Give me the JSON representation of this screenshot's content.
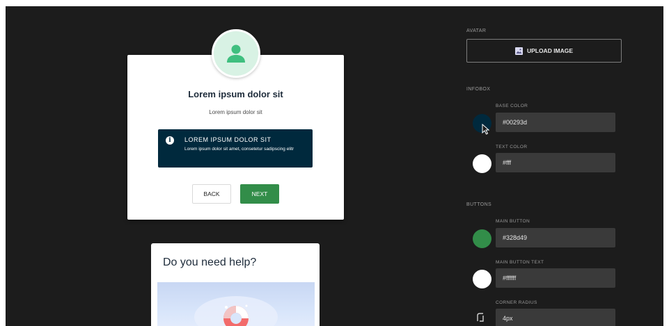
{
  "colors": {
    "panel_bg": "#1c1c1c",
    "infobox_base": "#00293d",
    "infobox_text": "#fff",
    "main_button": "#328d49",
    "main_button_text": "#ffffff",
    "avatar_bg": "#d8f2e4",
    "avatar_icon": "#3fbf7f"
  },
  "preview": {
    "avatar_icon": "user-icon",
    "title": "Lorem ipsum dolor sit",
    "subtitle": "Lorem ipsum dolor sit",
    "infobox": {
      "icon": "info-icon",
      "icon_glyph": "i",
      "title": "LOREM IPSUM DOLOR SIT",
      "text": "Lorem ipsum dolor sit amet, consetetur sadipscing elitr"
    },
    "back_label": "BACK",
    "next_label": "NEXT"
  },
  "help": {
    "title": "Do you need help?",
    "image_icon": "lifebuoy-icon"
  },
  "settings": {
    "avatar": {
      "section": "AVATAR",
      "upload_label": "UPLOAD IMAGE",
      "upload_icon": "image-icon"
    },
    "infobox": {
      "section": "INFOBOX",
      "base_color_label": "BASE COLOR",
      "base_color_value": "#00293d",
      "text_color_label": "TEXT COLOR",
      "text_color_value": "#fff"
    },
    "buttons": {
      "section": "BUTTONS",
      "main_button_label": "MAIN BUTTON",
      "main_button_value": "#328d49",
      "main_button_text_label": "MAIN BUTTON TEXT",
      "main_button_text_value": "#ffffff",
      "corner_radius_label": "CORNER RADIUS",
      "corner_radius_value": "4px",
      "corner_radius_icon": "corner-radius-icon"
    }
  }
}
